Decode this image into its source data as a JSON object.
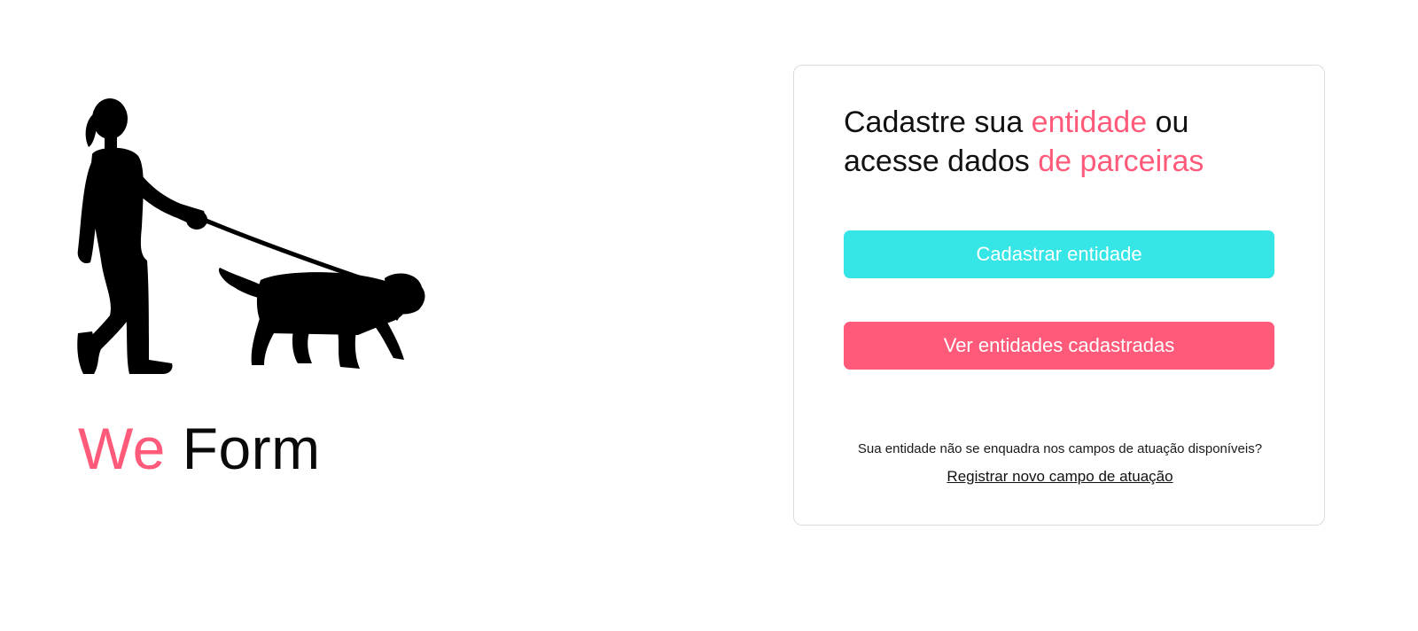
{
  "brand": {
    "accent_word": "We",
    "rest_word": "Form",
    "accent_color": "#ff5a79"
  },
  "illustration": {
    "icon": "woman-walking-dog-silhouette-icon"
  },
  "card": {
    "headline": {
      "part1": "Cadastre sua ",
      "highlight1": "entidade",
      "part2": " ou acesse dados ",
      "highlight2": "de parceiras"
    },
    "register_button_label": "Cadastrar entidade",
    "view_button_label": "Ver entidades cadastradas",
    "footer_question": "Sua entidade não se enquadra nos campos de atuação disponíveis?",
    "footer_link_label": "Registrar novo campo de atuação"
  },
  "colors": {
    "pink": "#ff5a79",
    "cyan": "#36e6e6",
    "text": "#111111"
  }
}
